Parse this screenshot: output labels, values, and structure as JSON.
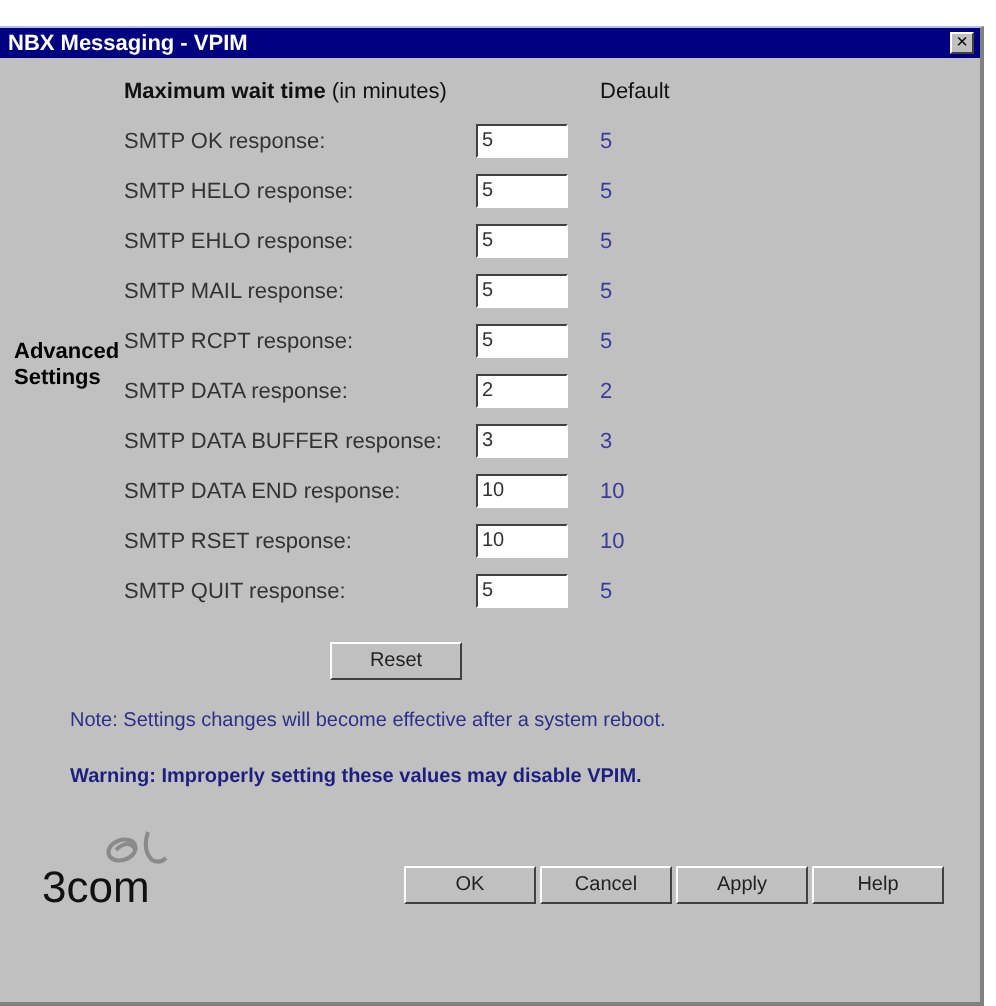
{
  "window": {
    "title": "NBX Messaging - VPIM",
    "close": "×"
  },
  "section_label": "Advanced Settings",
  "header": {
    "label": "**Maximum wait time** (in minutes)",
    "default": "Default"
  },
  "rows": [
    {
      "label": "SMTP OK response:",
      "value": "5",
      "default": "5"
    },
    {
      "label": "SMTP HELO response:",
      "value": "5",
      "default": "5"
    },
    {
      "label": "SMTP EHLO response:",
      "value": "5",
      "default": "5"
    },
    {
      "label": "SMTP MAIL response:",
      "value": "5",
      "default": "5"
    },
    {
      "label": "SMTP RCPT response:",
      "value": "5",
      "default": "5"
    },
    {
      "label": "SMTP DATA response:",
      "value": "2",
      "default": "2"
    },
    {
      "label": "SMTP DATA BUFFER response:",
      "value": "3",
      "default": "3"
    },
    {
      "label": "SMTP DATA END response:",
      "value": "10",
      "default": "10"
    },
    {
      "label": "SMTP RSET response:",
      "value": "10",
      "default": "10"
    },
    {
      "label": "SMTP QUIT response:",
      "value": "5",
      "default": "5"
    }
  ],
  "reset_button": "Reset",
  "note": "Note: Settings changes will become effective after a system reboot.",
  "warning": "Warning: Improperly setting these values may disable VPIM.",
  "logo": "3com",
  "buttons": [
    "OK",
    "Cancel",
    "Apply",
    "Help"
  ]
}
